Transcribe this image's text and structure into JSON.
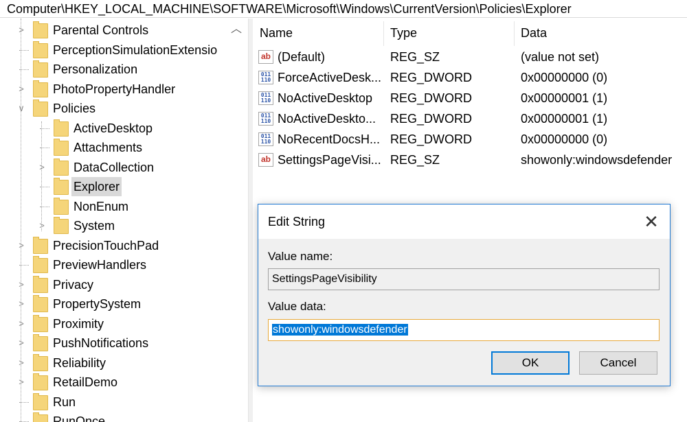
{
  "address_bar": {
    "path": "Computer\\HKEY_LOCAL_MACHINE\\SOFTWARE\\Microsoft\\Windows\\CurrentVersion\\Policies\\Explorer"
  },
  "tree": {
    "items": [
      {
        "label": "Parental Controls",
        "level": 0,
        "expandable": true
      },
      {
        "label": "PerceptionSimulationExtensio",
        "level": 0,
        "expandable": false
      },
      {
        "label": "Personalization",
        "level": 0,
        "expandable": false
      },
      {
        "label": "PhotoPropertyHandler",
        "level": 0,
        "expandable": true
      },
      {
        "label": "Policies",
        "level": 0,
        "expandable": true,
        "expanded": true
      },
      {
        "label": "ActiveDesktop",
        "level": 1,
        "expandable": false
      },
      {
        "label": "Attachments",
        "level": 1,
        "expandable": false
      },
      {
        "label": "DataCollection",
        "level": 1,
        "expandable": true
      },
      {
        "label": "Explorer",
        "level": 1,
        "expandable": false,
        "selected": true
      },
      {
        "label": "NonEnum",
        "level": 1,
        "expandable": false
      },
      {
        "label": "System",
        "level": 1,
        "expandable": true
      },
      {
        "label": "PrecisionTouchPad",
        "level": 0,
        "expandable": true
      },
      {
        "label": "PreviewHandlers",
        "level": 0,
        "expandable": false
      },
      {
        "label": "Privacy",
        "level": 0,
        "expandable": true
      },
      {
        "label": "PropertySystem",
        "level": 0,
        "expandable": true
      },
      {
        "label": "Proximity",
        "level": 0,
        "expandable": true
      },
      {
        "label": "PushNotifications",
        "level": 0,
        "expandable": true
      },
      {
        "label": "Reliability",
        "level": 0,
        "expandable": true
      },
      {
        "label": "RetailDemo",
        "level": 0,
        "expandable": true
      },
      {
        "label": "Run",
        "level": 0,
        "expandable": false
      },
      {
        "label": "RunOnce",
        "level": 0,
        "expandable": false
      }
    ]
  },
  "list": {
    "headers": {
      "name": "Name",
      "type": "Type",
      "data": "Data"
    },
    "rows": [
      {
        "icon": "string-value-icon",
        "name": "(Default)",
        "type": "REG_SZ",
        "data": "(value not set)"
      },
      {
        "icon": "binary-value-icon",
        "name": "ForceActiveDesk...",
        "type": "REG_DWORD",
        "data": "0x00000000 (0)"
      },
      {
        "icon": "binary-value-icon",
        "name": "NoActiveDesktop",
        "type": "REG_DWORD",
        "data": "0x00000001 (1)"
      },
      {
        "icon": "binary-value-icon",
        "name": "NoActiveDeskto...",
        "type": "REG_DWORD",
        "data": "0x00000001 (1)"
      },
      {
        "icon": "binary-value-icon",
        "name": "NoRecentDocsH...",
        "type": "REG_DWORD",
        "data": "0x00000000 (0)"
      },
      {
        "icon": "string-value-icon",
        "name": "SettingsPageVisi...",
        "type": "REG_SZ",
        "data": "showonly:windowsdefender"
      }
    ]
  },
  "dialog": {
    "title": "Edit String",
    "close_glyph": "✕",
    "value_name_label": "Value name:",
    "value_name": "SettingsPageVisibility",
    "value_data_label": "Value data:",
    "value_data": "showonly:windowsdefender",
    "ok_label": "OK",
    "cancel_label": "Cancel"
  }
}
